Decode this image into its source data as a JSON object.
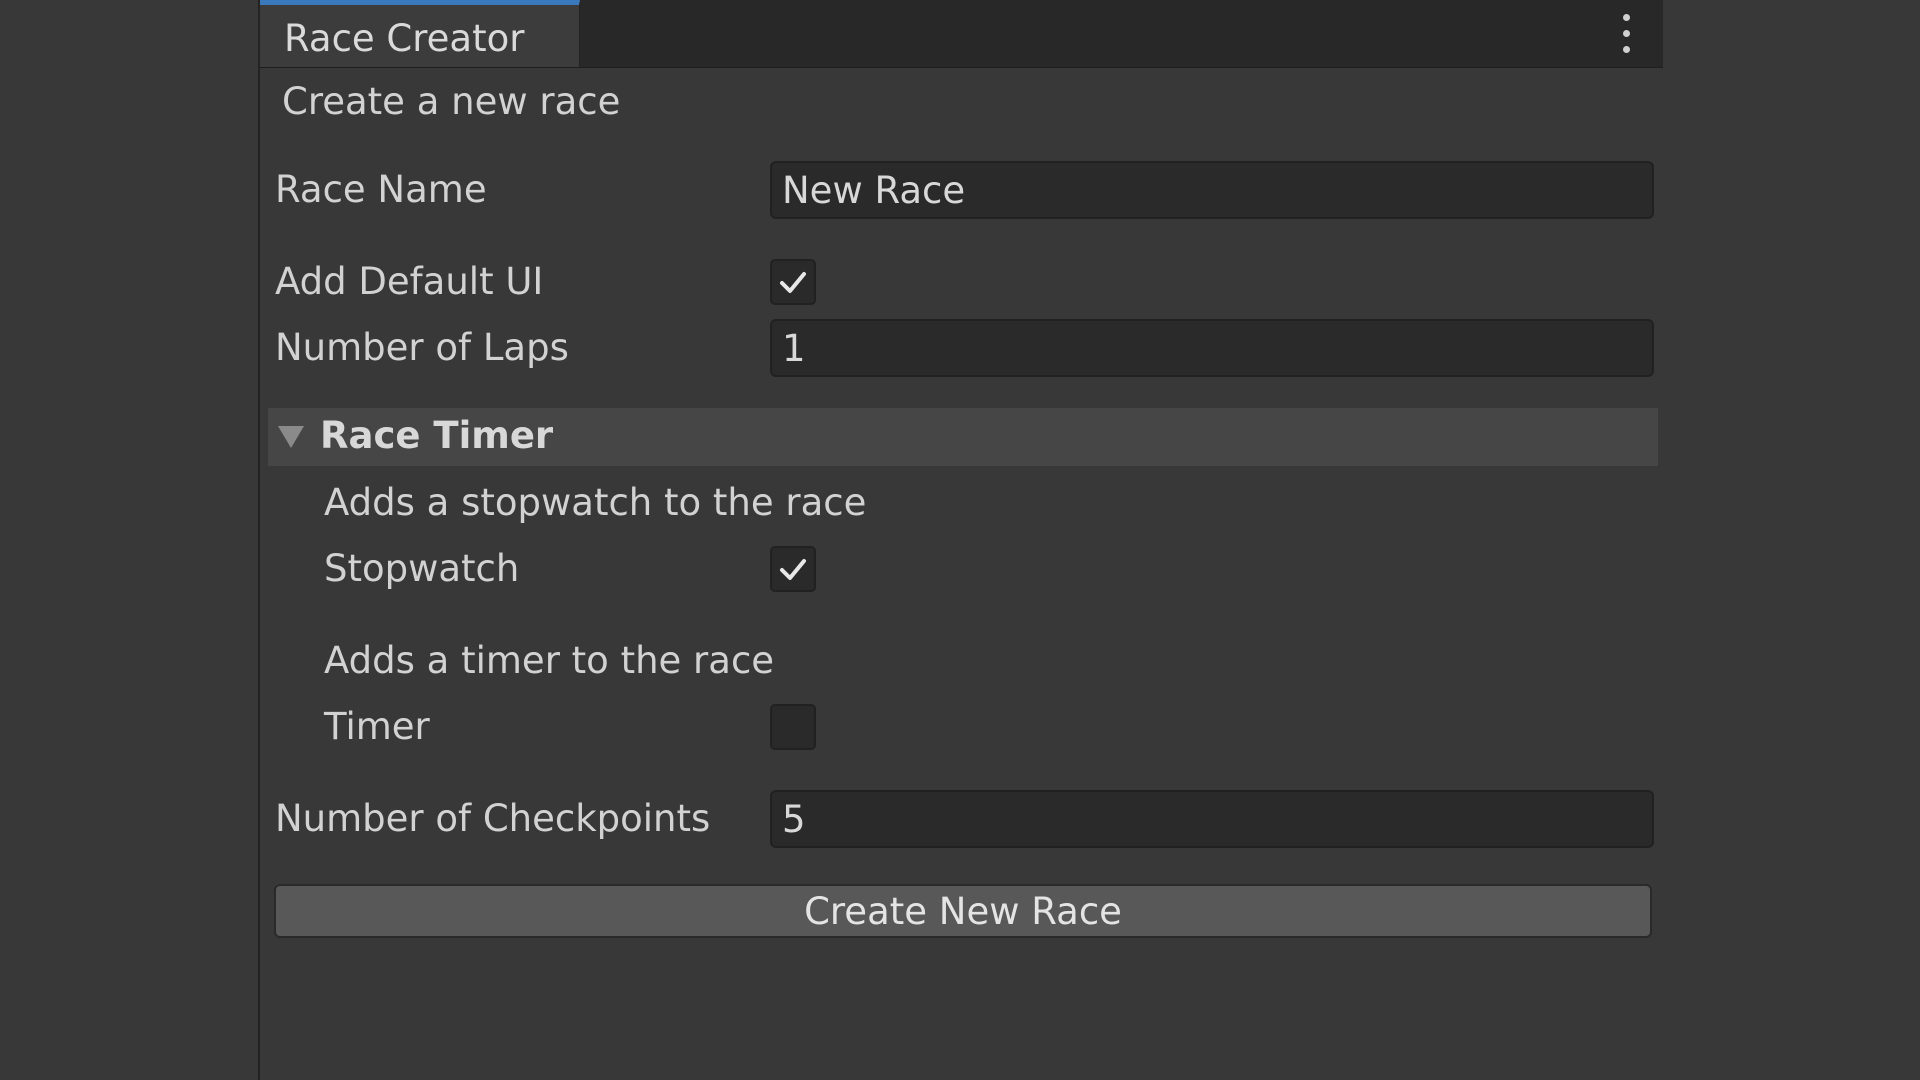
{
  "window": {
    "tab_title": "Race Creator",
    "menu_icon": "kebab-menu-icon"
  },
  "form": {
    "heading": "Create a new race",
    "race_name_label": "Race Name",
    "race_name_value": "New Race",
    "add_default_ui_label": "Add Default UI",
    "add_default_ui_checked": true,
    "number_of_laps_label": "Number of Laps",
    "number_of_laps_value": "1",
    "race_timer": {
      "label": "Race Timer",
      "expanded": true,
      "stopwatch_help": "Adds a stopwatch to the race",
      "stopwatch_label": "Stopwatch",
      "stopwatch_checked": true,
      "timer_help": "Adds a timer to the race",
      "timer_label": "Timer",
      "timer_checked": false
    },
    "number_of_checkpoints_label": "Number of Checkpoints",
    "number_of_checkpoints_value": "5",
    "create_button_label": "Create New Race"
  },
  "colors": {
    "background": "#383838",
    "tab_accent": "#3a79bb",
    "field_background": "#2a2a2a",
    "button_background": "#585858"
  }
}
